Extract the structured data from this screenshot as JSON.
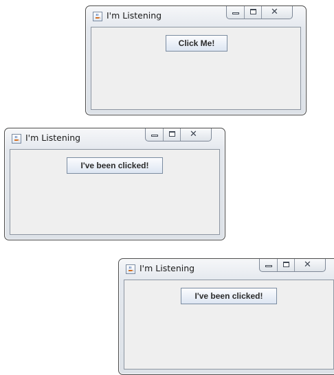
{
  "windows": [
    {
      "title": "I'm Listening",
      "button_label": "Click Me!",
      "controls": {
        "minimize": "minimize",
        "maximize": "maximize",
        "close": "close"
      }
    },
    {
      "title": "I'm Listening",
      "button_label": "I've been clicked!",
      "controls": {
        "minimize": "minimize",
        "maximize": "maximize",
        "close": "close"
      }
    },
    {
      "title": "I'm Listening",
      "button_label": "I've been clicked!",
      "controls": {
        "minimize": "minimize",
        "maximize": "maximize",
        "close": "close"
      }
    }
  ],
  "icons": {
    "app": "java-coffee-cup-icon",
    "minimize": "minimize-icon",
    "maximize": "maximize-icon",
    "close": "close-icon"
  },
  "colors": {
    "frame_border": "#4a4a4a",
    "title_gradient_top": "#f6f7f9",
    "title_gradient_bottom": "#dde2e8",
    "client_background": "#efefef",
    "button_gradient_top": "#fbfcfe",
    "button_gradient_bottom": "#dde6f2",
    "button_border": "#7a8ba0"
  }
}
